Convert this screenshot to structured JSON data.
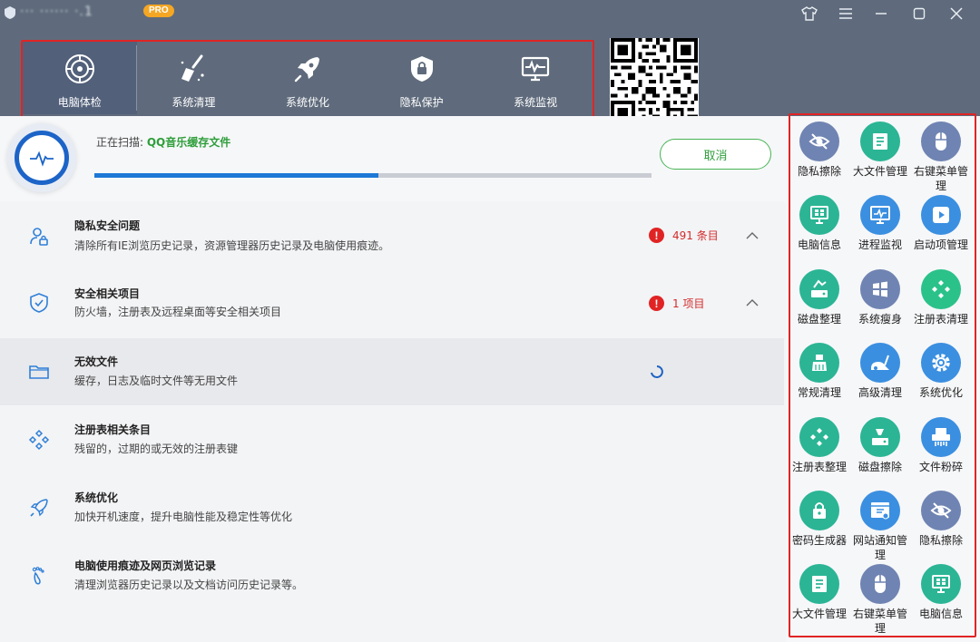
{
  "app": {
    "title": "··· ······ ·.1",
    "badge": "PRO"
  },
  "nav": [
    {
      "label": "电脑体检",
      "icon": "radar-icon"
    },
    {
      "label": "系统清理",
      "icon": "broom-icon"
    },
    {
      "label": "系统优化",
      "icon": "rocket-icon"
    },
    {
      "label": "隐私保护",
      "icon": "shield-lock-icon"
    },
    {
      "label": "系统监视",
      "icon": "monitor-pulse-icon"
    }
  ],
  "scan": {
    "prefix": "正在扫描: ",
    "target": "QQ音乐缓存文件",
    "progress_percent": 51,
    "cancel": "取消"
  },
  "items": [
    {
      "title": "隐私安全问题",
      "desc": "清除所有IE浏览历史记录，资源管理器历史记录及电脑使用痕迹。",
      "count": "491 条目",
      "icon": "user-lock-icon"
    },
    {
      "title": "安全相关项目",
      "desc": "防火墙，注册表及远程桌面等安全相关项目",
      "count": "1 项目",
      "icon": "shield-check-icon"
    },
    {
      "title": "无效文件",
      "desc": "缓存，日志及临时文件等无用文件",
      "icon": "folder-icon"
    },
    {
      "title": "注册表相关条目",
      "desc": "残留的，过期的或无效的注册表键",
      "icon": "registry-icon"
    },
    {
      "title": "系统优化",
      "desc": "加快开机速度，提升电脑性能及稳定性等优化",
      "icon": "rocket-icon"
    },
    {
      "title": "电脑使用痕迹及网页浏览记录",
      "desc": "清理浏览器历史记录以及文档访问历史记录等。",
      "icon": "footprint-icon"
    }
  ],
  "tools": [
    {
      "label": "隐私擦除",
      "icon": "eye-off-icon",
      "color": "#6f84b2"
    },
    {
      "label": "大文件管理",
      "icon": "file-list-icon",
      "color": "#2bb595"
    },
    {
      "label": "右键菜单管理",
      "icon": "mouse-icon",
      "color": "#6f84b2"
    },
    {
      "label": "电脑信息",
      "icon": "computer-icon",
      "color": "#2bb595"
    },
    {
      "label": "进程监视",
      "icon": "process-monitor-icon",
      "color": "#3b8fe0"
    },
    {
      "label": "启动项管理",
      "icon": "play-icon",
      "color": "#3b8fe0"
    },
    {
      "label": "磁盘整理",
      "icon": "disk-defrag-icon",
      "color": "#2bb595"
    },
    {
      "label": "系统瘦身",
      "icon": "windows-icon",
      "color": "#6f84b2"
    },
    {
      "label": "注册表清理",
      "icon": "registry-icon",
      "color": "#2bc28a"
    },
    {
      "label": "常规清理",
      "icon": "broom-icon",
      "color": "#2bb595"
    },
    {
      "label": "高级清理",
      "icon": "vacuum-icon",
      "color": "#3b8fe0"
    },
    {
      "label": "系统优化",
      "icon": "gear-icon",
      "color": "#3b8fe0"
    },
    {
      "label": "注册表整理",
      "icon": "registry-icon",
      "color": "#2bb595"
    },
    {
      "label": "磁盘擦除",
      "icon": "disk-erase-icon",
      "color": "#2bb595"
    },
    {
      "label": "文件粉碎",
      "icon": "shredder-icon",
      "color": "#3b8fe0"
    },
    {
      "label": "密码生成器",
      "icon": "lock-icon",
      "color": "#2bb595"
    },
    {
      "label": "网站通知管理",
      "icon": "bell-web-icon",
      "color": "#3b8fe0"
    },
    {
      "label": "隐私擦除",
      "icon": "eye-off-icon",
      "color": "#6f84b2"
    },
    {
      "label": "大文件管理",
      "icon": "file-list-icon",
      "color": "#2bb595"
    },
    {
      "label": "右键菜单管理",
      "icon": "mouse-icon",
      "color": "#6f84b2"
    },
    {
      "label": "电脑信息",
      "icon": "computer-icon",
      "color": "#2bb595"
    }
  ]
}
